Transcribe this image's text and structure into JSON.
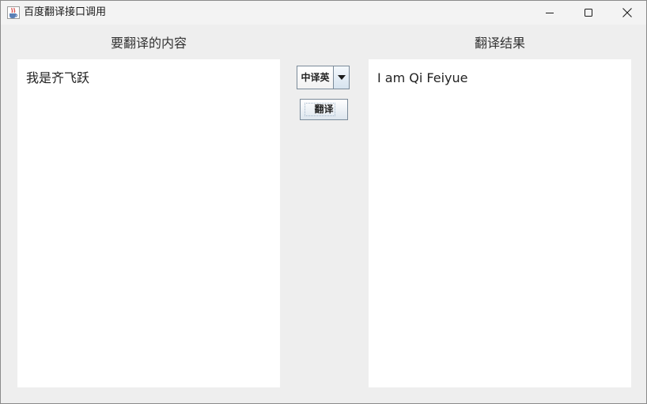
{
  "window": {
    "title": "百度翻译接口调用",
    "icons": {
      "app": "java-cup-icon",
      "minimize": "minimize-icon",
      "maximize": "maximize-icon",
      "close": "close-icon"
    }
  },
  "source": {
    "heading": "要翻译的内容",
    "text": "我是齐飞跃"
  },
  "controls": {
    "direction_selected": "中译英",
    "translate_label": "翻译"
  },
  "result": {
    "heading": "翻译结果",
    "text": "I am Qi Feiyue"
  },
  "colors": {
    "background": "#eeeeee",
    "text_area": "#ffffff",
    "button_border": "#7a8a99"
  }
}
